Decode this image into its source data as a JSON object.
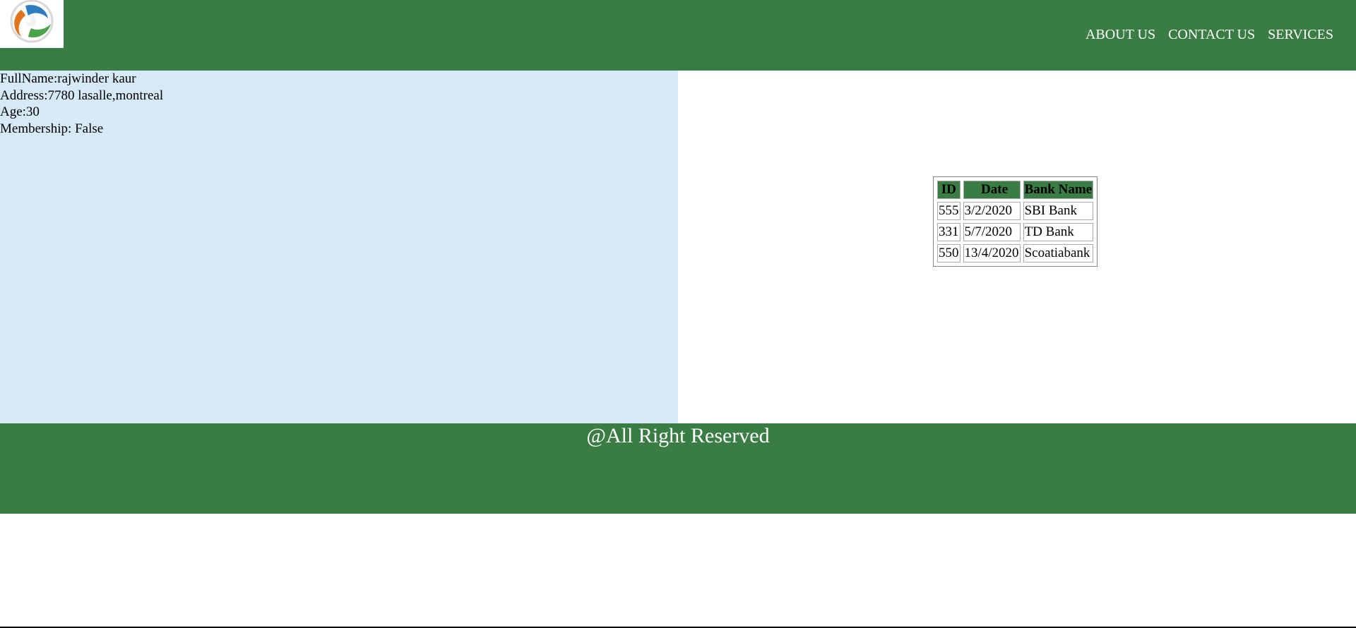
{
  "header": {
    "logo_icon": "circular-swirl-logo-icon",
    "nav": [
      {
        "label": "ABOUT US"
      },
      {
        "label": "CONTACT US"
      },
      {
        "label": "SERVICES"
      }
    ]
  },
  "profile": {
    "full_name": "FullName:rajwinder kaur",
    "address": "Address:7780 lasalle,montreal",
    "age": "Age:30",
    "membership": "Membership: False"
  },
  "banks_table": {
    "headers": [
      "ID",
      "Date",
      "Bank Name"
    ],
    "rows": [
      [
        "555",
        "3/2/2020",
        "SBI Bank"
      ],
      [
        "331",
        "5/7/2020",
        "TD Bank"
      ],
      [
        "550",
        "13/4/2020",
        "Scoatiabank"
      ]
    ]
  },
  "footer": {
    "text": "@All Right Reserved"
  },
  "colors": {
    "header_green": "#3a7d44",
    "panel_blue": "#d6e9f7"
  }
}
